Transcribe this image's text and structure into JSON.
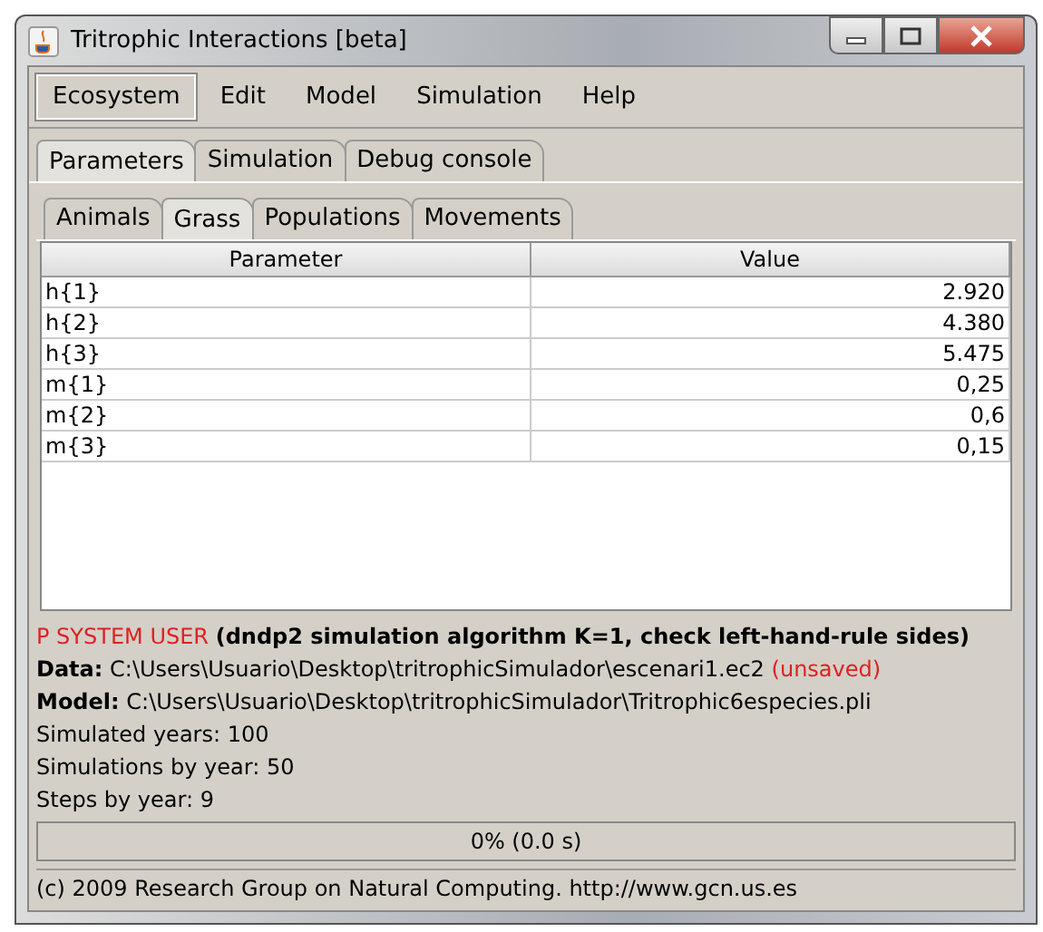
{
  "window": {
    "title": "Tritrophic Interactions [beta]"
  },
  "menu": [
    {
      "label": "Ecosystem",
      "selected": true
    },
    {
      "label": "Edit",
      "selected": false
    },
    {
      "label": "Model",
      "selected": false
    },
    {
      "label": "Simulation",
      "selected": false
    },
    {
      "label": "Help",
      "selected": false
    }
  ],
  "tabs": [
    {
      "label": "Parameters",
      "selected": true
    },
    {
      "label": "Simulation",
      "selected": false
    },
    {
      "label": "Debug console",
      "selected": false
    }
  ],
  "subtabs": [
    {
      "label": "Animals",
      "selected": false
    },
    {
      "label": "Grass",
      "selected": true
    },
    {
      "label": "Populations",
      "selected": false
    },
    {
      "label": "Movements",
      "selected": false
    }
  ],
  "table": {
    "columns": [
      "Parameter",
      "Value"
    ],
    "rows": [
      [
        "h{1}",
        "2.920"
      ],
      [
        "h{2}",
        "4.380"
      ],
      [
        "h{3}",
        "5.475"
      ],
      [
        "m{1}",
        "0,25"
      ],
      [
        "m{2}",
        "0,6"
      ],
      [
        "m{3}",
        "0,15"
      ]
    ]
  },
  "info": {
    "user": "P SYSTEM USER",
    "algorithm": "(dndp2 simulation algorithm K=1, check left-hand-rule sides)",
    "data": {
      "label": "Data:",
      "path": "C:\\Users\\Usuario\\Desktop\\tritrophicSimulador\\escenari1.ec2",
      "note": "(unsaved)"
    },
    "model": {
      "label": "Model:",
      "path": "C:\\Users\\Usuario\\Desktop\\tritrophicSimulador\\Tritrophic6especies.pli"
    },
    "stats": [
      "Simulated years: 100",
      "Simulations by year: 50",
      "Steps by year: 9"
    ]
  },
  "progress": {
    "level": 0,
    "text": "0% (0.0 s)"
  },
  "status_bar": "(c) 2009 Research Group on Natural Computing. http://www.gcn.us.es"
}
